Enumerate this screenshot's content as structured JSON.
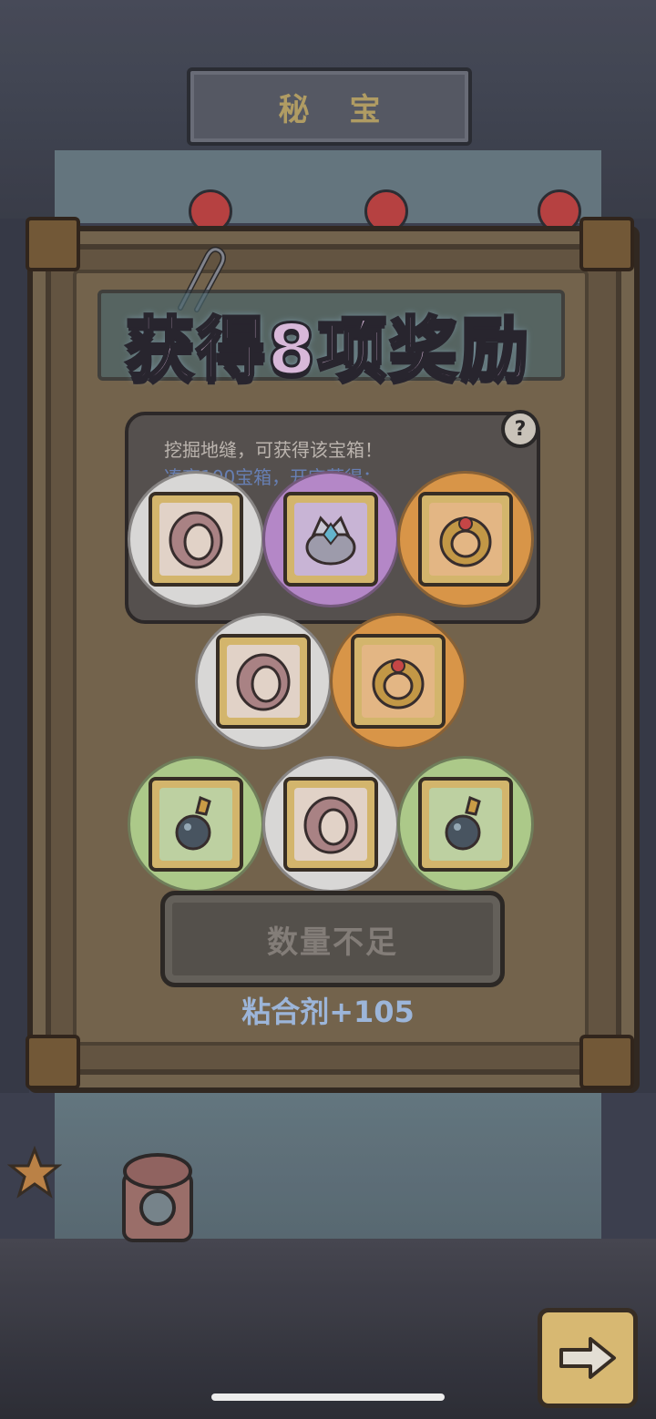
{
  "header": {
    "title": "秘宝"
  },
  "headline": "获得8项奖励",
  "info": {
    "line1": "挖掘地缝，可获得该宝箱！",
    "line2": "凑齐100宝箱，开宝获得："
  },
  "help_icon_glyph": "?",
  "rewards": [
    {
      "rarity": "white",
      "item": "ring-icon"
    },
    {
      "rarity": "purple",
      "item": "crowned-ring-icon"
    },
    {
      "rarity": "orange",
      "item": "ruby-ring-icon"
    },
    {
      "rarity": "white",
      "item": "ring-icon"
    },
    {
      "rarity": "orange",
      "item": "ruby-ring-icon"
    },
    {
      "rarity": "green",
      "item": "pendant-icon"
    },
    {
      "rarity": "white",
      "item": "ring-icon"
    },
    {
      "rarity": "green",
      "item": "pendant-icon"
    }
  ],
  "button": {
    "label": "数量不足"
  },
  "reward_text": "粘合剂+105",
  "colors": {
    "white": "#e9e8e6",
    "purple": "#c291d6",
    "orange": "#e9a04c",
    "green": "#b9d893",
    "accent_text": "#a8c3ea"
  }
}
